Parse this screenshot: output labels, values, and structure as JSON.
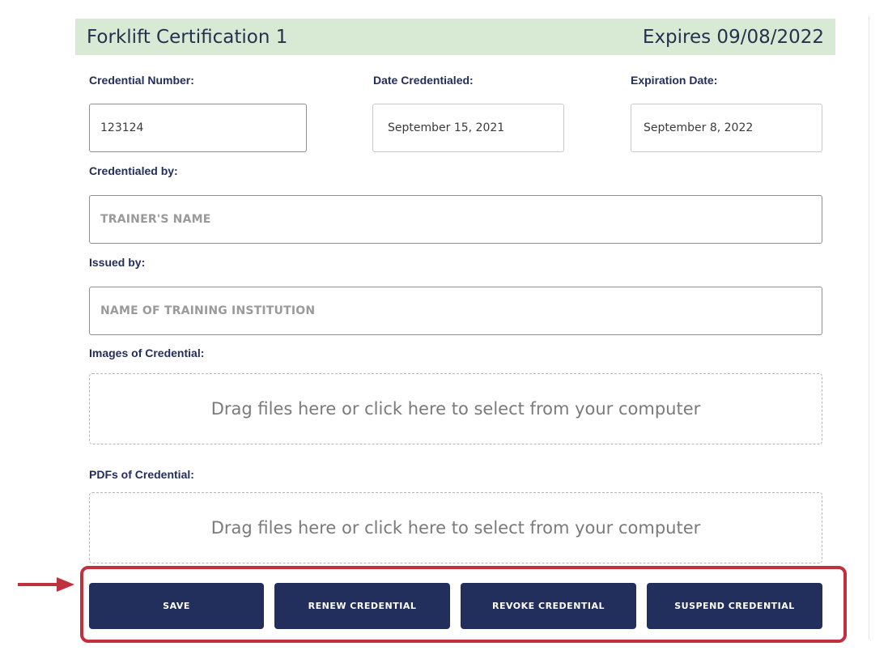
{
  "header": {
    "title": "Forklift Certification 1",
    "expiry": "Expires 09/08/2022"
  },
  "fields": {
    "credential_number": {
      "label": "Credential Number:",
      "value": "123124"
    },
    "date_credentialed": {
      "label": "Date Credentialed:",
      "value": "September 15, 2021"
    },
    "expiration_date": {
      "label": "Expiration Date:",
      "value": "September 8, 2022"
    },
    "credentialed_by": {
      "label": "Credentialed by:",
      "placeholder": "TRAINER'S NAME"
    },
    "issued_by": {
      "label": "Issued by:",
      "placeholder": "NAME OF TRAINING INSTITUTION"
    }
  },
  "uploads": {
    "images": {
      "label": "Images of Credential:",
      "prompt": "Drag files here or click here to select from your computer"
    },
    "pdfs": {
      "label": "PDFs of Credential:",
      "prompt": "Drag files here or click here to select from your computer"
    }
  },
  "actions": {
    "save": "SAVE",
    "renew": "RENEW CREDENTIAL",
    "revoke": "REVOKE CREDENTIAL",
    "suspend": "SUSPEND CREDENTIAL"
  },
  "colors": {
    "header_bg": "#d8ead4",
    "button_bg": "#222e5c",
    "label_text": "#232e5c",
    "highlight": "#c0313f"
  }
}
